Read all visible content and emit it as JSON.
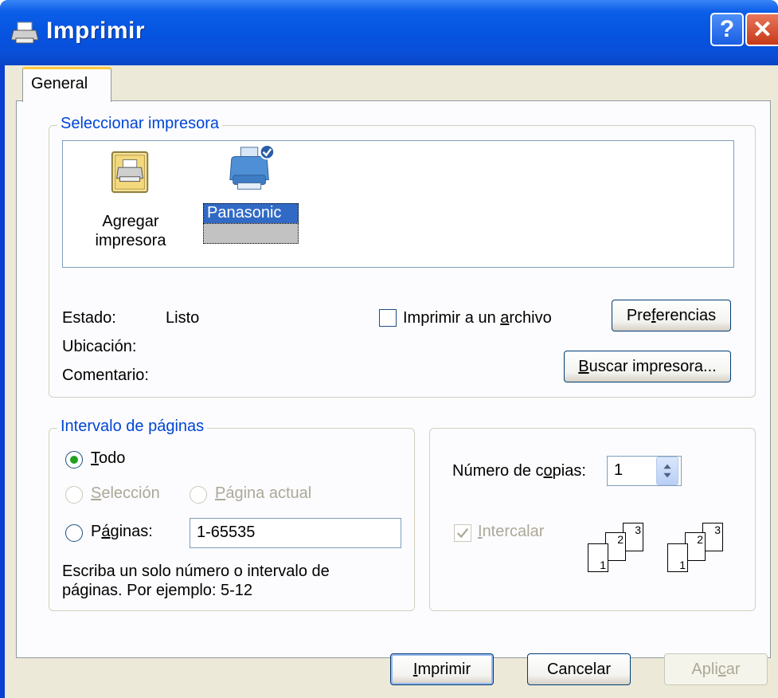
{
  "window": {
    "title": "Imprimir",
    "help_symbol": "?",
    "close_symbol": "✕"
  },
  "tabs": [
    {
      "label": "General"
    }
  ],
  "select_printer": {
    "legend": "Seleccionar impresora",
    "items": [
      {
        "label_line1": "Agregar",
        "label_line2": "impresora"
      },
      {
        "label": "Panasonic",
        "selected": true
      }
    ],
    "status_label": "Estado:",
    "status_value": "Listo",
    "location_label": "Ubicación:",
    "comment_label": "Comentario:",
    "print_to_file_label_pre": "Imprimir a un ",
    "print_to_file_label_key": "a",
    "print_to_file_label_post": "rchivo",
    "preferences_pre": "Pre",
    "preferences_key": "f",
    "preferences_post": "erencias",
    "find_printer_key": "B",
    "find_printer_post": "uscar impresora..."
  },
  "page_range": {
    "legend": "Intervalo de páginas",
    "all_key": "T",
    "all_post": "odo",
    "selection_key": "S",
    "selection_post": "elección",
    "current_key": "P",
    "current_post": "ágina actual",
    "pages_pre": "P",
    "pages_key": "á",
    "pages_post": "ginas:",
    "pages_value": "1-65535",
    "hint_line1": "Escriba un solo número o intervalo de",
    "hint_line2": "páginas. Por ejemplo: 5-12"
  },
  "copies": {
    "label_pre": "Número de c",
    "label_key": "o",
    "label_post": "pias:",
    "value": "1",
    "collate_key": "I",
    "collate_post": "ntercalar",
    "sheet_numbers": [
      "1",
      "2",
      "3"
    ]
  },
  "footer": {
    "print_key": "I",
    "print_post": "mprimir",
    "cancel": "Cancelar",
    "apply_pre": "Apli",
    "apply_key": "c",
    "apply_post": "ar"
  },
  "colors": {
    "titlebar": "#0553e0",
    "client": "#ece9d8",
    "legend": "#0046d5",
    "selection": "#316ac5"
  }
}
